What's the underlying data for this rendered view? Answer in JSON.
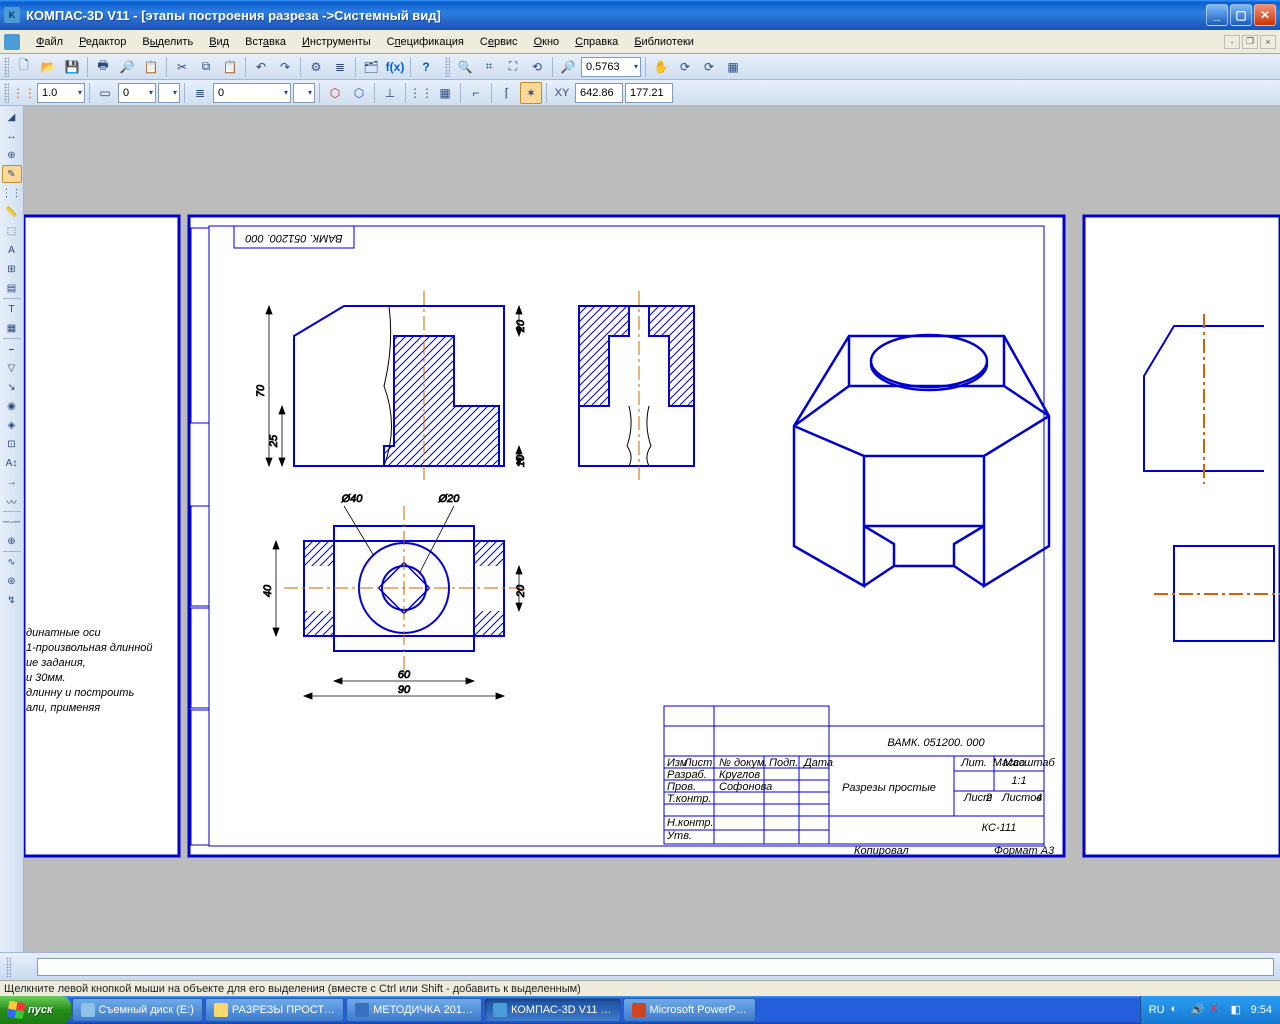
{
  "title": "КОМПАС-3D V11 - [этапы построения разреза ->Системный вид]",
  "menu": {
    "file": "Файл",
    "edit": "Редактор",
    "select": "Выделить",
    "view": "Вид",
    "insert": "Вставка",
    "tools": "Инструменты",
    "spec": "Спецификация",
    "service": "Сервис",
    "window": "Окно",
    "help": "Справка",
    "lib": "Библиотеки"
  },
  "toolbar2": {
    "zoom_value": "0.5763"
  },
  "toolbar3": {
    "step_value": "1.0",
    "layer_value": "0",
    "type_value": "0",
    "coord_label": "XY",
    "coord_x": "642.86",
    "coord_y": "177.21"
  },
  "drawing": {
    "doc_number_top": "ВАМК. 051200. 000",
    "dims": {
      "d70": "70",
      "d25": "25",
      "d20": "20",
      "d10": "10",
      "d40a": "40",
      "d20b": "20",
      "d60": "60",
      "d90": "90",
      "phi40": "Ø40",
      "phi20": "Ø20"
    },
    "title_block": {
      "number": "ВАМК. 051200. 000",
      "name": "Разрезы простые",
      "group": "КС-111",
      "scale_lbl": "Масштаб",
      "scale": "1:1",
      "mass_lbl": "Масса",
      "lit_lbl": "Лит.",
      "sheet_lbl": "Лист",
      "sheet": "2",
      "sheets_lbl": "Листов",
      "sheets": "4",
      "format_lbl": "Формат",
      "format": "А3",
      "kopir": "Копировал",
      "row_izm": "Изм",
      "row_list": "Лист",
      "row_doc": "№ докум.",
      "row_podp": "Подп.",
      "row_data": "Дата",
      "row_razrab": "Разраб.",
      "row_razrab_n": "Круглов",
      "row_prov": "Пров.",
      "row_prov_n": "Софонова",
      "row_tkontr": "Т.контр.",
      "row_nkontr": "Н.контр.",
      "row_utv": "Утв."
    },
    "side_text": {
      "l1": "динатные оси",
      "l2": "1-произвольная длинной",
      "l3": "ие задания,",
      "l4": "и 30мм.",
      "l5": "длинну и построить",
      "l6": "али, применяя"
    }
  },
  "status": "Щелкните левой кнопкой мыши на объекте для его выделения (вместе с Ctrl или Shift - добавить к выделенным)",
  "taskbar": {
    "start": "пуск",
    "t1": "Съемный диск (E:)",
    "t2": "РАЗРЕЗЫ ПРОСТ…",
    "t3": "МЕТОДИЧКА 201…",
    "t4": "КОМПАС-3D V11 …",
    "t5": "Microsoft PowerP…",
    "lang": "RU",
    "clock": "9:54"
  }
}
